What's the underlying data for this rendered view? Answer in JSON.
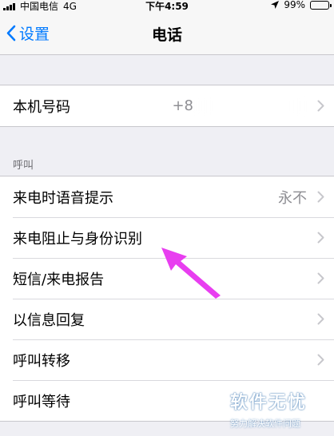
{
  "status_bar": {
    "carrier": "中国电信",
    "network": "4G",
    "time": "下午4:59",
    "battery_text": "99%",
    "battery_level": 0.99
  },
  "nav": {
    "back_label": "设置",
    "title": "电话"
  },
  "group1": {
    "items": [
      {
        "label": "本机号码",
        "value": "+8"
      }
    ]
  },
  "section_header": "呼叫",
  "group2": {
    "items": [
      {
        "label": "来电时语音提示",
        "value": "永不"
      },
      {
        "label": "来电阻止与身份识别"
      },
      {
        "label": "短信/来电报告"
      },
      {
        "label": "以信息回复"
      },
      {
        "label": "呼叫转移"
      },
      {
        "label": "呼叫等待"
      }
    ]
  },
  "annotation_color": "#e83ef0",
  "watermark": {
    "brand": "软件无忧",
    "sub": "努力解决软件问题"
  }
}
